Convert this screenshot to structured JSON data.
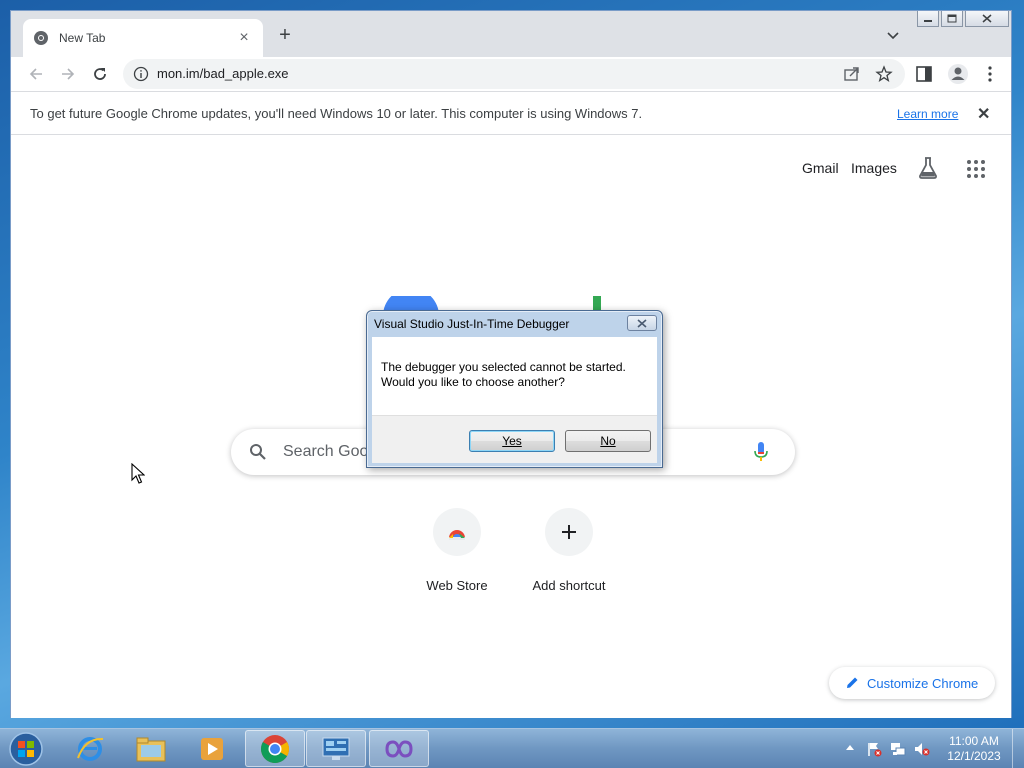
{
  "browser": {
    "tab": {
      "title": "New Tab",
      "favicon": "chrome-icon",
      "close": "×"
    },
    "new_tab": "+",
    "url": "mon.im/bad_apple.exe",
    "infobar": {
      "message": "To get future Google Chrome updates, you'll need Windows 10 or later. This computer is using Windows 7.",
      "link": "Learn more",
      "close": "✕"
    }
  },
  "newtab_page": {
    "links": {
      "gmail": "Gmail",
      "images": "Images"
    },
    "search_placeholder": "Search Goo",
    "shortcuts": [
      {
        "label": "Web Store",
        "icon": "web-store-icon"
      },
      {
        "label": "Add shortcut",
        "icon": "plus-icon"
      }
    ],
    "customize": "Customize Chrome"
  },
  "dialog": {
    "title": "Visual Studio Just-In-Time Debugger",
    "message_line1": "The debugger you selected cannot be started.",
    "message_line2": "Would you like to choose another?",
    "yes": "Yes",
    "no": "No"
  },
  "taskbar": {
    "items": [
      "start-orb",
      "internet-explorer",
      "file-explorer",
      "media-player",
      "chrome",
      "control-panel",
      "visual-studio"
    ],
    "clock_time": "11:00 AM",
    "clock_date": "12/1/2023"
  },
  "colors": {
    "accent": "#1a73e8",
    "taskbar": "#6f97c2",
    "dialog_frame": "#bed3ea"
  }
}
